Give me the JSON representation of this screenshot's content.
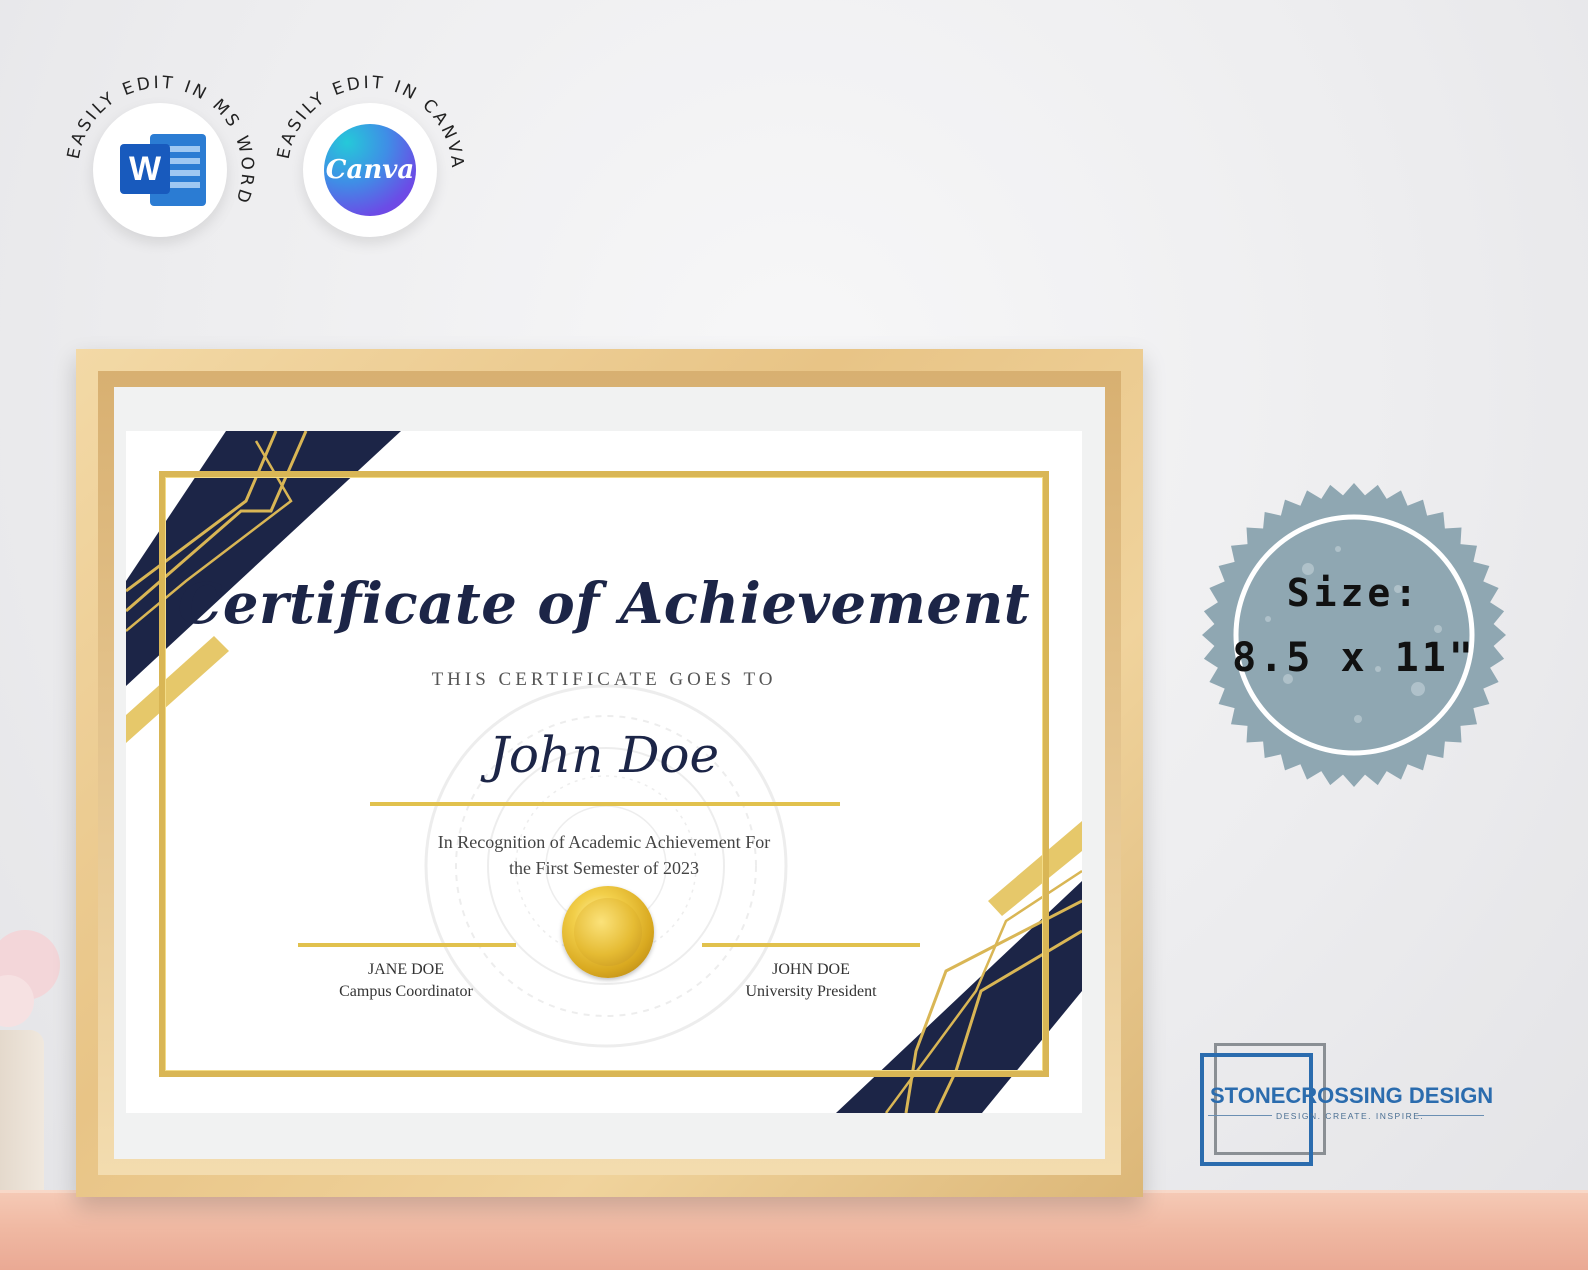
{
  "badges": {
    "word": {
      "ring_text": "EASILY EDIT IN MS WORD",
      "icon_letter": "W"
    },
    "canva": {
      "ring_text": "EASILY EDIT IN CANVA",
      "icon_text": "Canva"
    }
  },
  "certificate": {
    "title": "Certificate of Achievement",
    "subtitle": "THIS CERTIFICATE GOES TO",
    "recipient": "John Doe",
    "recognition_line1": "In Recognition of Academic Achievement For",
    "recognition_line2": "the First Semester of 2023",
    "signer_left": {
      "name": "JANE DOE",
      "role": "Campus Coordinator"
    },
    "signer_right": {
      "name": "JOHN DOE",
      "role": "University President"
    }
  },
  "size_stamp": {
    "label": "Size:",
    "value": "8.5 x 11\""
  },
  "logo": {
    "name": "STONECROSSING DESIGN",
    "tagline": "DESIGN. CREATE. INSPIRE."
  },
  "colors": {
    "navy": "#1c2547",
    "gold": "#d9b655",
    "stamp": "#8fa7b2",
    "brand_blue": "#2b6cae"
  }
}
